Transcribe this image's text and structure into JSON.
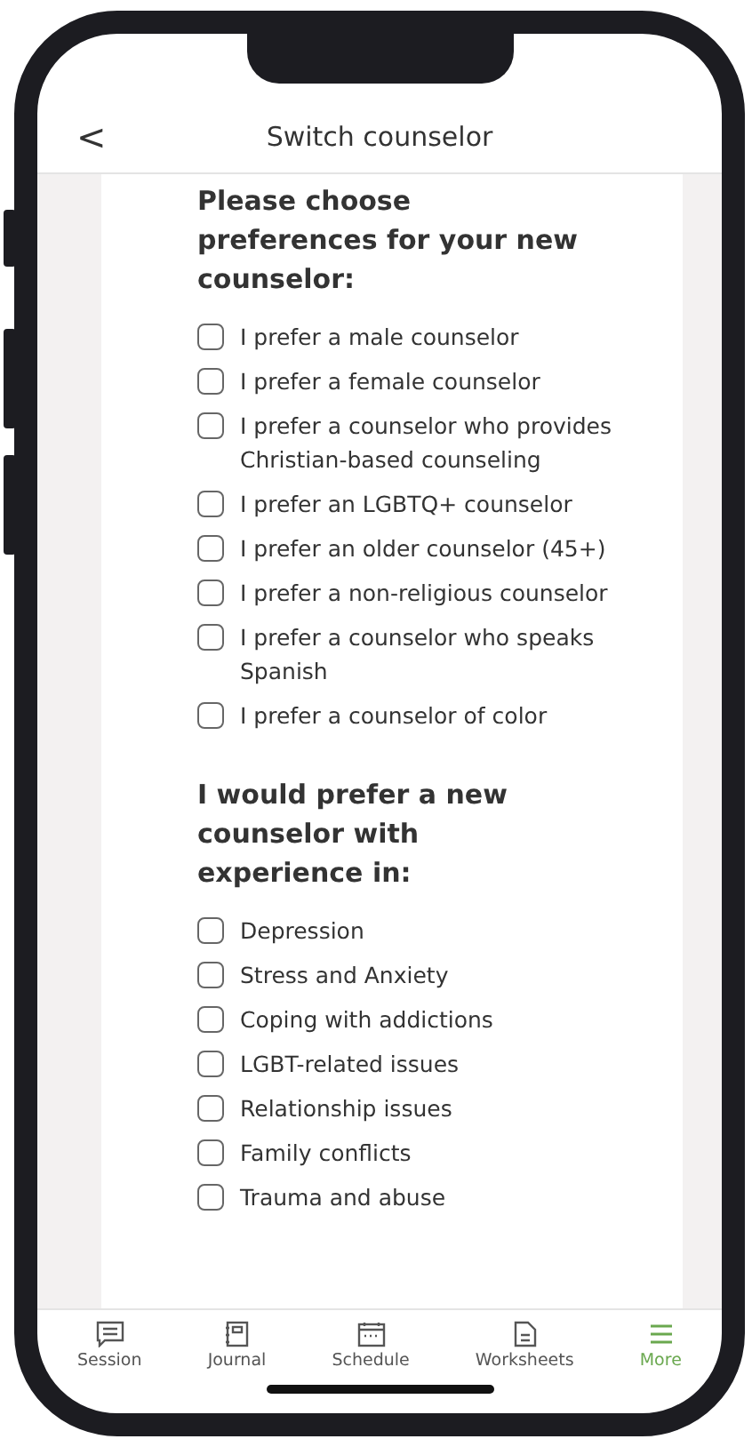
{
  "header": {
    "back": "<",
    "title": "Switch counselor"
  },
  "sections": [
    {
      "heading": "Please choose preferences for your new counselor:",
      "options": [
        {
          "label": "I prefer a male counselor",
          "checked": false
        },
        {
          "label": "I prefer a female counselor",
          "checked": false
        },
        {
          "label": "I prefer a counselor who provides Christian-based counseling",
          "checked": false
        },
        {
          "label": "I prefer an LGBTQ+ counselor",
          "checked": false
        },
        {
          "label": "I prefer an older counselor (45+)",
          "checked": false
        },
        {
          "label": "I prefer a non-religious counselor",
          "checked": false
        },
        {
          "label": "I prefer a counselor who speaks Spanish",
          "checked": false
        },
        {
          "label": "I prefer a counselor of color",
          "checked": false
        }
      ]
    },
    {
      "heading": "I would prefer a new counselor with experience in:",
      "options": [
        {
          "label": "Depression",
          "checked": false
        },
        {
          "label": "Stress and Anxiety",
          "checked": false
        },
        {
          "label": "Coping with addictions",
          "checked": false
        },
        {
          "label": "LGBT-related issues",
          "checked": false
        },
        {
          "label": "Relationship issues",
          "checked": false
        },
        {
          "label": "Family conflicts",
          "checked": false
        },
        {
          "label": "Trauma and abuse",
          "checked": false
        }
      ]
    }
  ],
  "tabs": [
    {
      "label": "Session",
      "kind": "chat",
      "selected": false
    },
    {
      "label": "Journal",
      "kind": "notebook",
      "selected": false
    },
    {
      "label": "Schedule",
      "kind": "calendar",
      "selected": false
    },
    {
      "label": "Worksheets",
      "kind": "document",
      "selected": false
    },
    {
      "label": "More",
      "kind": "menu",
      "selected": true
    }
  ]
}
